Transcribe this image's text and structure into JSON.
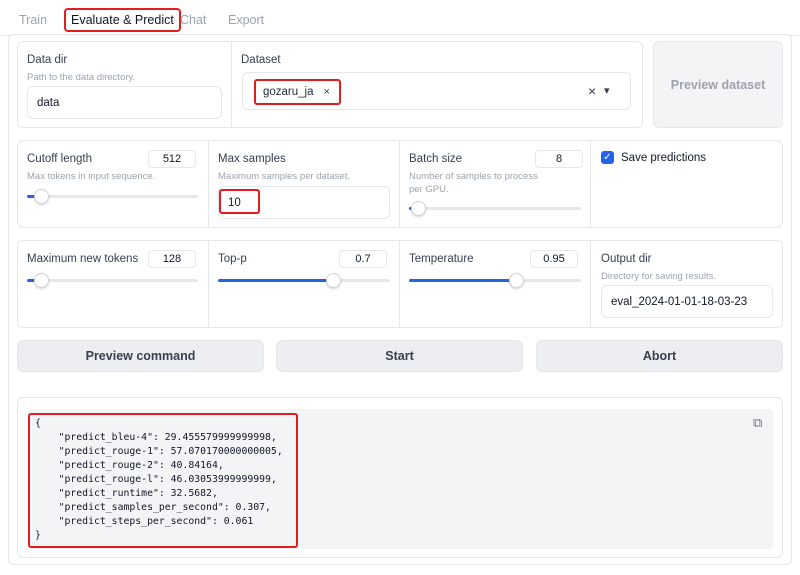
{
  "tabs": [
    {
      "label": "Train"
    },
    {
      "label": "Evaluate & Predict"
    },
    {
      "label": "Chat"
    },
    {
      "label": "Export"
    }
  ],
  "data_dir": {
    "label": "Data dir",
    "info": "Path to the data directory.",
    "value": "data"
  },
  "dataset": {
    "label": "Dataset",
    "chip": "gozaru_ja",
    "chip_remove": "×",
    "clear": "×",
    "dropdown": "▾"
  },
  "preview_dataset": {
    "label": "Preview dataset"
  },
  "cutoff_length": {
    "label": "Cutoff length",
    "info": "Max tokens in input sequence.",
    "value": "512",
    "fraction": 0.08
  },
  "max_samples": {
    "label": "Max samples",
    "info": "Maximum samples per dataset.",
    "value": "10"
  },
  "batch_size": {
    "label": "Batch size",
    "info": "Number of samples to process per GPU.",
    "value": "8",
    "fraction": 0.05
  },
  "save_predictions": {
    "label": "Save predictions",
    "checked": true,
    "check": "✓"
  },
  "max_new_tokens": {
    "label": "Maximum new tokens",
    "value": "128",
    "fraction": 0.08
  },
  "top_p": {
    "label": "Top-p",
    "value": "0.7",
    "fraction": 0.67
  },
  "temperature": {
    "label": "Temperature",
    "value": "0.95",
    "fraction": 0.62
  },
  "output_dir": {
    "label": "Output dir",
    "info": "Directory for saving results.",
    "value": "eval_2024-01-01-18-03-23"
  },
  "buttons": {
    "preview_command": "Preview command",
    "start": "Start",
    "abort": "Abort"
  },
  "copy_icon": "⧉",
  "output_lines": [
    "{",
    "    \"predict_bleu-4\": 29.455579999999998,",
    "    \"predict_rouge-1\": 57.070170000000005,",
    "    \"predict_rouge-2\": 40.84164,",
    "    \"predict_rouge-l\": 46.03053999999999,",
    "    \"predict_runtime\": 32.5682,",
    "    \"predict_samples_per_second\": 0.307,",
    "    \"predict_steps_per_second\": 0.061",
    "}"
  ]
}
